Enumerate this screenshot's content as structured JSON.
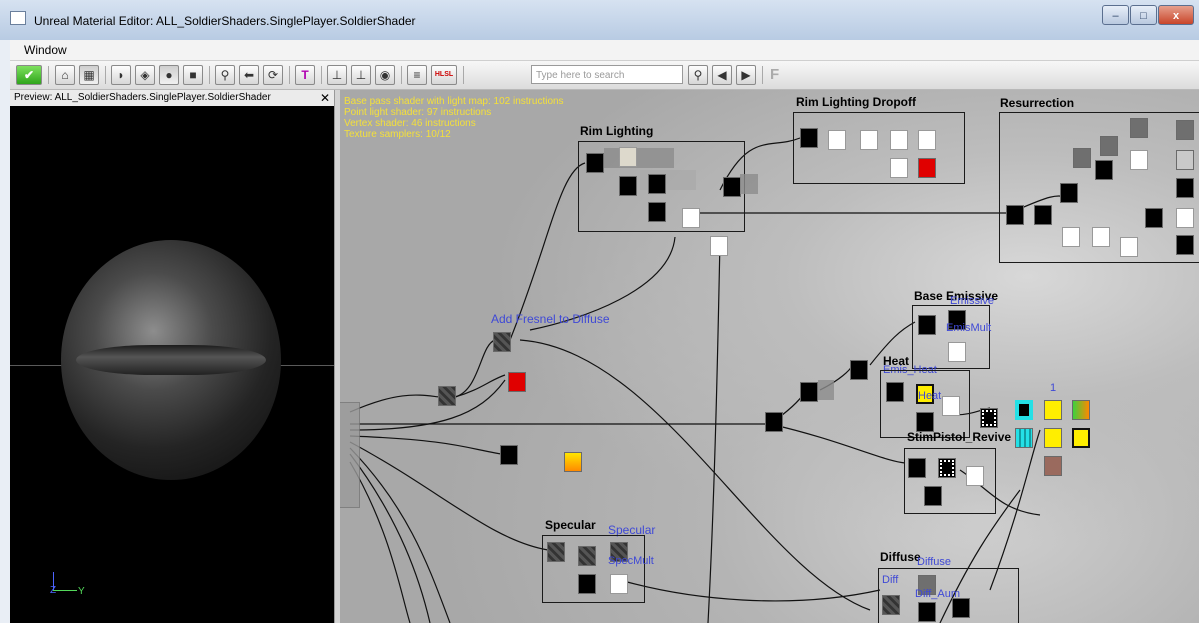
{
  "window": {
    "title": "Unreal Material Editor: ALL_SoldierShaders.SinglePlayer.SoldierShader",
    "minimize": "–",
    "maximize": "□",
    "close": "x"
  },
  "menu": {
    "window": "Window"
  },
  "toolbar": {
    "search_placeholder": "Type here to search",
    "hlsl_label": "HLSL",
    "f_label": "F"
  },
  "preview": {
    "title": "Preview: ALL_SoldierShaders.SinglePlayer.SoldierShader",
    "close": "✕",
    "axis_z": "Z",
    "axis_y": "Y"
  },
  "stats": [
    "Base pass shader with light map: 102 instructions",
    "Point light shader: 97 instructions",
    "Vertex shader: 46 instructions",
    "Texture samplers: 10/12"
  ],
  "groups": {
    "rim_lighting": "Rim Lighting",
    "rim_dropoff": "Rim Lighting Dropoff",
    "resurrection": "Resurrection",
    "base_emissive": "Base Emissive",
    "heat": "Heat",
    "stim": "StimPistol_Revive",
    "specular": "Specular",
    "diffuse": "Diffuse"
  },
  "labels": {
    "add_fresnel": "Add Fresnel to Diffuse",
    "emissive": "Emissive",
    "emis_mult": "EmisMult",
    "emis_heat": "Emis_Heat",
    "heat": "Heat",
    "one": "1",
    "specular": "Specular",
    "spec_mult": "SpecMult",
    "diffuse": "Diffuse",
    "diff": "Diff",
    "diff_aum": "Diff_Aum"
  },
  "colors": {
    "stats_text": "#f4e03a",
    "comment_label": "#3f49d6",
    "red_node": "#e00000"
  }
}
